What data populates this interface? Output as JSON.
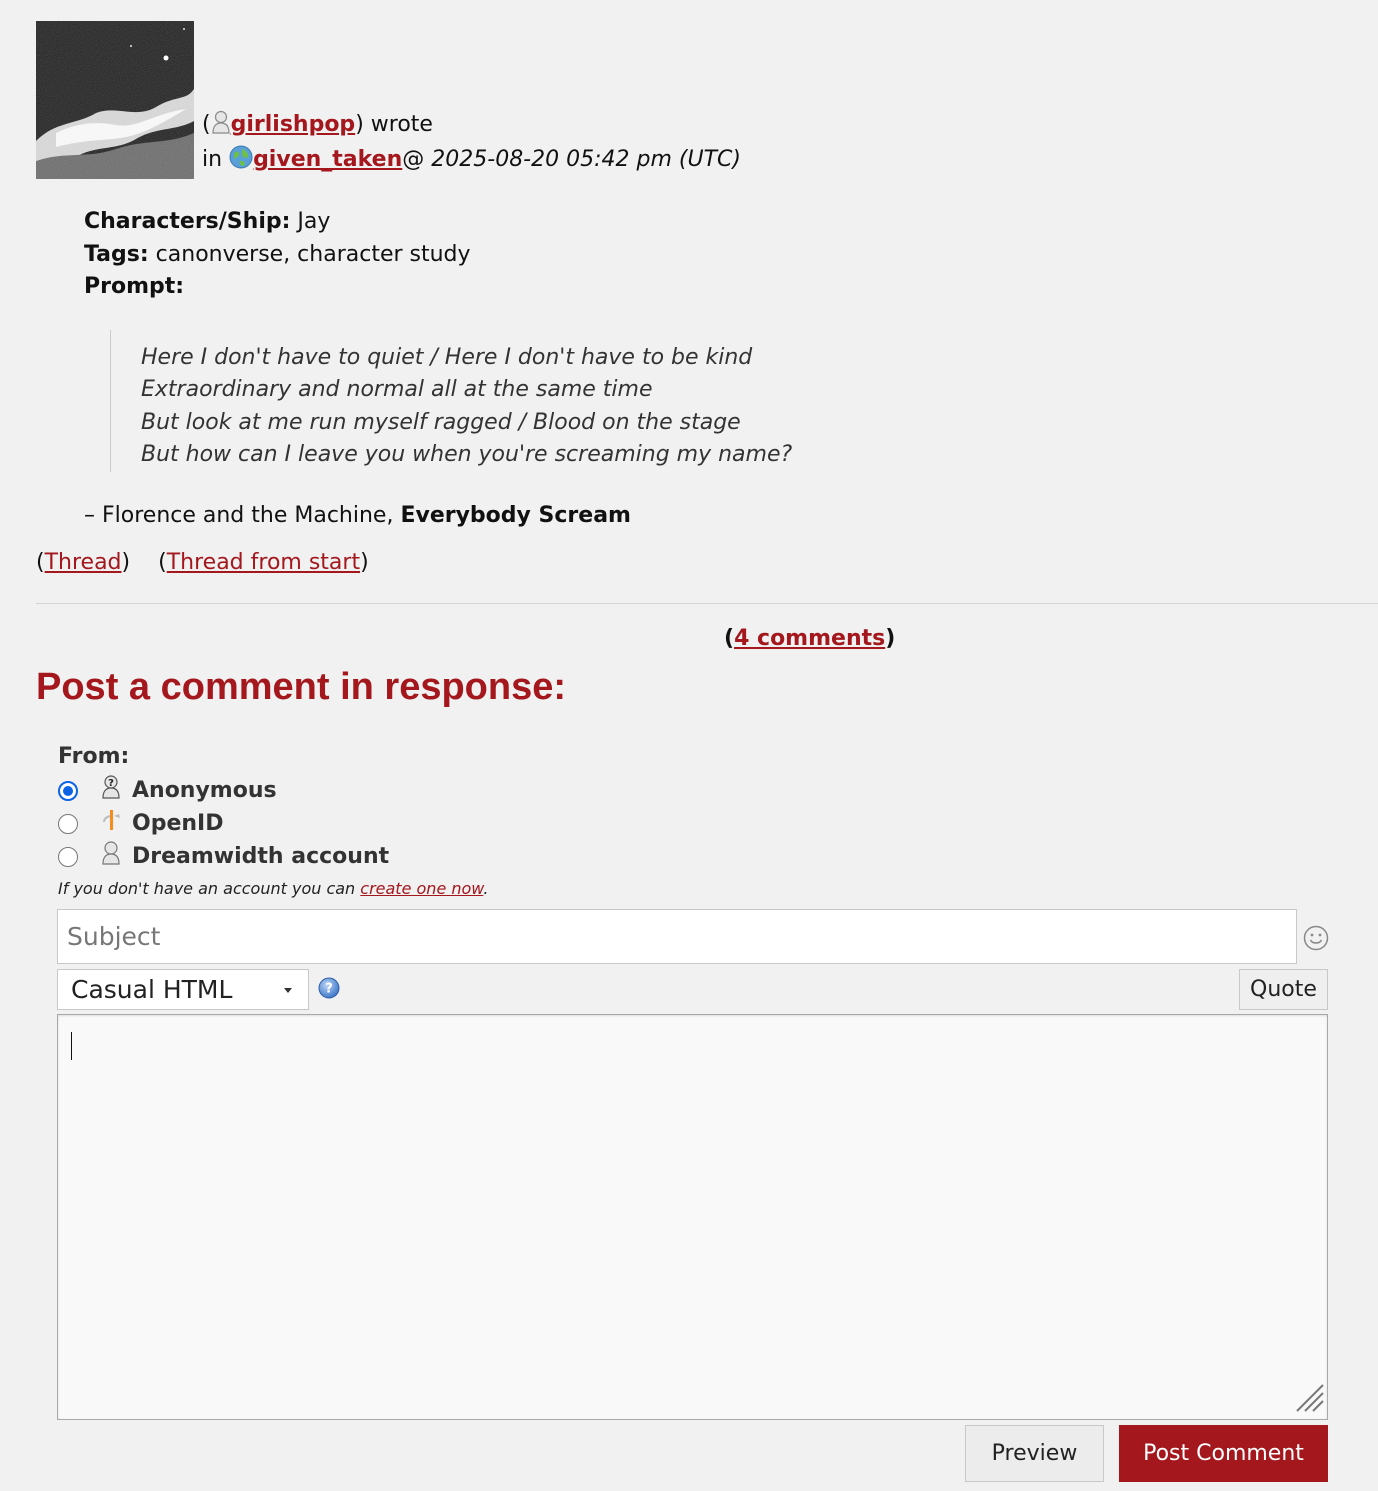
{
  "entry": {
    "open_paren": "(",
    "author": "girlishpop",
    "wrote": ") wrote",
    "in": "in",
    "community": "given_taken",
    "at": "@",
    "date": "2025-08-20 05:42 pm (UTC)",
    "fields": [
      {
        "label": "Characters/Ship:",
        "value": "Jay"
      },
      {
        "label": "Tags:",
        "value": "canonverse, character study"
      },
      {
        "label": "Prompt:",
        "value": ""
      }
    ],
    "quote_lines": [
      "Here I don't have to quiet / Here I don't have to be kind",
      "Extraordinary and normal all at the same time",
      "But look at me run myself ragged / Blood on the stage",
      "But how can I leave you when you're screaming my name?"
    ],
    "attribution_prefix": "– Florence and the Machine, ",
    "attribution_title": "Everybody Scream"
  },
  "thread_links": {
    "thread": "Thread",
    "thread_from_start": "Thread from start"
  },
  "comments": {
    "link": "4 comments"
  },
  "form": {
    "heading": "Post a comment in response:",
    "from_label": "From:",
    "options": [
      {
        "label": "Anonymous",
        "icon": "anonymous-icon",
        "selected": true
      },
      {
        "label": "OpenID",
        "icon": "openid-icon",
        "selected": false
      },
      {
        "label": "Dreamwidth account",
        "icon": "user-icon",
        "selected": false
      }
    ],
    "account_note_prefix": "If you don't have an account you can ",
    "account_note_link": "create one now",
    "account_note_suffix": ".",
    "subject_placeholder": "Subject",
    "format_selected": "Casual HTML",
    "quote_label": "Quote",
    "preview_label": "Preview",
    "post_label": "Post Comment"
  },
  "colors": {
    "accent": "#a3171d",
    "background": "#f1f1f1",
    "radio_checked": "#0b63e6"
  }
}
